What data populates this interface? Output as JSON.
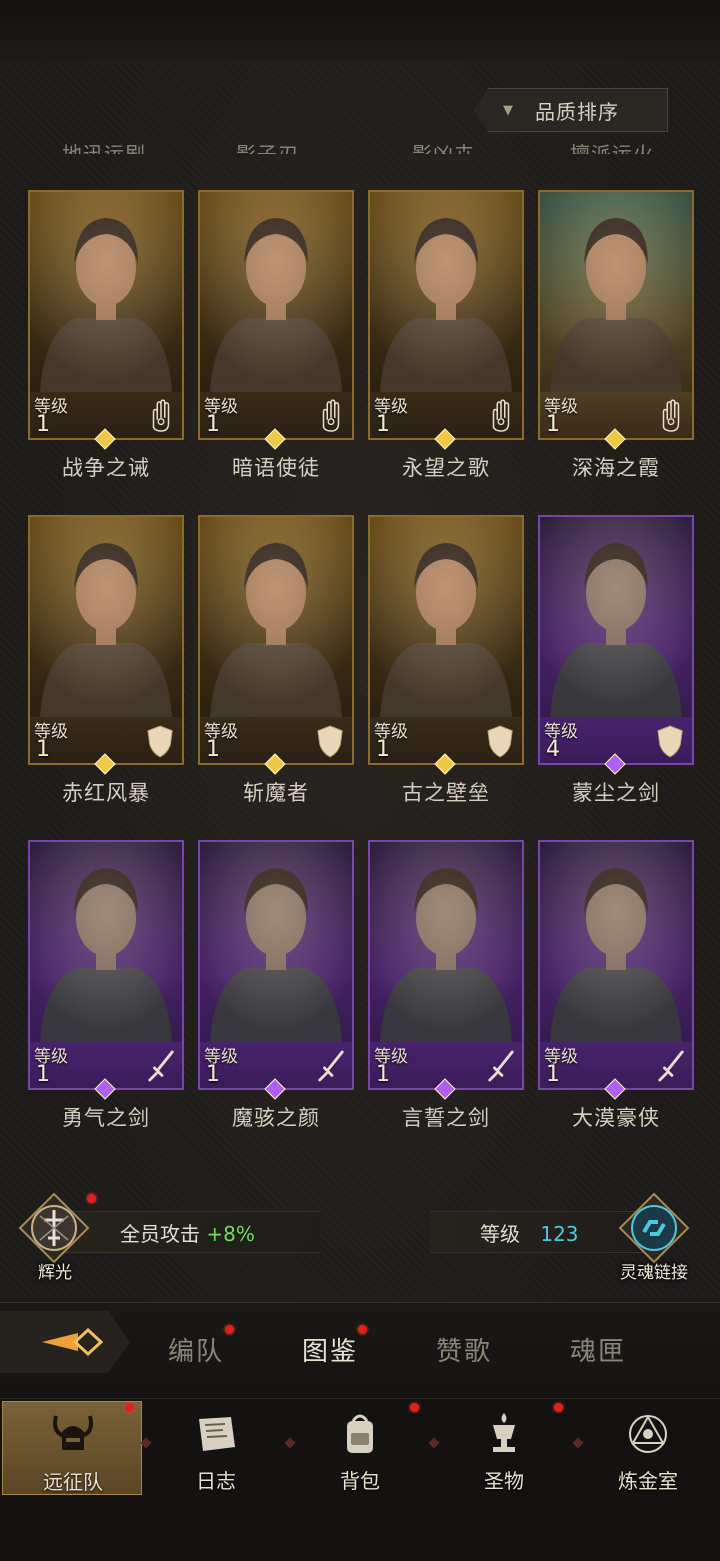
{
  "sort": {
    "label": "品质排序",
    "arrow": "▼"
  },
  "cut_names": [
    "地迅运剧",
    "影子刃",
    "影凶卉",
    "擅派运火"
  ],
  "heroes": [
    {
      "name": "战争之诫",
      "level_label": "等级",
      "level": "1",
      "rarity": "gold",
      "class_icon": "hand-icon"
    },
    {
      "name": "暗语使徒",
      "level_label": "等级",
      "level": "1",
      "rarity": "gold",
      "class_icon": "hand-icon"
    },
    {
      "name": "永望之歌",
      "level_label": "等级",
      "level": "1",
      "rarity": "gold",
      "class_icon": "hand-icon"
    },
    {
      "name": "深海之霞",
      "level_label": "等级",
      "level": "1",
      "rarity": "gold",
      "class_icon": "hand-icon"
    },
    {
      "name": "赤红风暴",
      "level_label": "等级",
      "level": "1",
      "rarity": "gold",
      "class_icon": "shield-icon"
    },
    {
      "name": "斩魔者",
      "level_label": "等级",
      "level": "1",
      "rarity": "gold",
      "class_icon": "shield-icon"
    },
    {
      "name": "古之壁垒",
      "level_label": "等级",
      "level": "1",
      "rarity": "gold",
      "class_icon": "shield-icon"
    },
    {
      "name": "蒙尘之剑",
      "level_label": "等级",
      "level": "4",
      "rarity": "purple",
      "class_icon": "shield-icon"
    },
    {
      "name": "勇气之剑",
      "level_label": "等级",
      "level": "1",
      "rarity": "purple",
      "class_icon": "sword-icon"
    },
    {
      "name": "魔骇之颜",
      "level_label": "等级",
      "level": "1",
      "rarity": "purple",
      "class_icon": "sword-icon"
    },
    {
      "name": "言誓之剑",
      "level_label": "等级",
      "level": "1",
      "rarity": "purple",
      "class_icon": "sword-icon"
    },
    {
      "name": "大漠豪侠",
      "level_label": "等级",
      "level": "1",
      "rarity": "purple",
      "class_icon": "sword-icon"
    }
  ],
  "stats": {
    "left_emblem_label": "辉光",
    "attack_label": "全员攻击",
    "attack_value": "+8%",
    "level_label": "等级",
    "level_value": "123",
    "right_emblem_label": "灵魂链接"
  },
  "tabs": [
    {
      "label": "编队",
      "badge": true,
      "active": false
    },
    {
      "label": "图鉴",
      "badge": true,
      "active": true
    },
    {
      "label": "赞歌",
      "badge": false,
      "active": false
    },
    {
      "label": "魂匣",
      "badge": false,
      "active": false
    }
  ],
  "nav": [
    {
      "label": "远征队",
      "icon": "horned-helmet-icon",
      "badge": true,
      "active": true
    },
    {
      "label": "日志",
      "icon": "scroll-icon",
      "badge": false,
      "active": false
    },
    {
      "label": "背包",
      "icon": "backpack-icon",
      "badge": true,
      "active": false
    },
    {
      "label": "圣物",
      "icon": "chalice-icon",
      "badge": true,
      "active": false
    },
    {
      "label": "炼金室",
      "icon": "alchemy-icon",
      "badge": false,
      "active": false
    }
  ],
  "colors": {
    "gold_frame": "#8c6a2c",
    "purple_frame": "#7a45a8",
    "accent_green": "#6fdc62",
    "accent_cyan": "#4cc8e0",
    "badge_red": "#e0201c"
  }
}
